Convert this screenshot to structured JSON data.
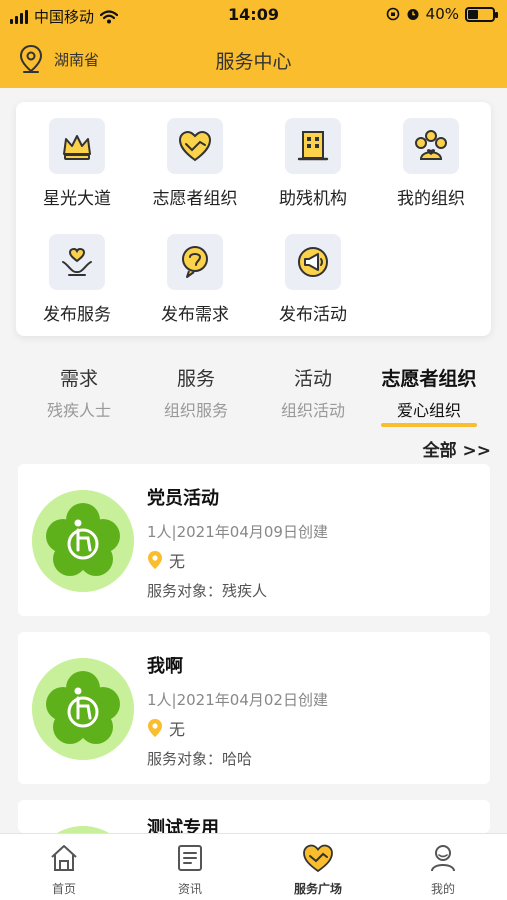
{
  "status_bar": {
    "carrier": "中国移动",
    "time": "14:09",
    "battery": "40%",
    "battery_level": 0.4
  },
  "header": {
    "location": "湖南省",
    "title": "服务中心",
    "accent": "#f9bd2d"
  },
  "grid": [
    {
      "label": "星光大道",
      "icon": "crown-icon"
    },
    {
      "label": "志愿者组织",
      "icon": "heart-hands-icon"
    },
    {
      "label": "助残机构",
      "icon": "building-icon"
    },
    {
      "label": "我的组织",
      "icon": "group-icon"
    },
    {
      "label": "发布服务",
      "icon": "heart-palm-icon"
    },
    {
      "label": "发布需求",
      "icon": "lightbulb-icon"
    },
    {
      "label": "发布活动",
      "icon": "megaphone-icon"
    }
  ],
  "tabs": [
    {
      "title": "需求",
      "subtitle": "残疾人士"
    },
    {
      "title": "服务",
      "subtitle": "组织服务"
    },
    {
      "title": "活动",
      "subtitle": "组织活动"
    },
    {
      "title": "志愿者组织",
      "subtitle": "爱心组织",
      "active": true
    }
  ],
  "all_link": "全部 >>",
  "organizations": [
    {
      "name": "党员活动",
      "meta": "1人|2021年04月09日创建",
      "location": "无",
      "target": "服务对象：残疾人"
    },
    {
      "name": "我啊",
      "meta": "1人|2021年04月02日创建",
      "location": "无",
      "target": "服务对象：哈哈"
    },
    {
      "name": "测试专用"
    }
  ],
  "tabbar": [
    {
      "label": "首页",
      "icon": "home-icon"
    },
    {
      "label": "资讯",
      "icon": "news-icon"
    },
    {
      "label": "服务广场",
      "icon": "heart-hands-icon",
      "active": true
    },
    {
      "label": "我的",
      "icon": "profile-icon"
    }
  ]
}
